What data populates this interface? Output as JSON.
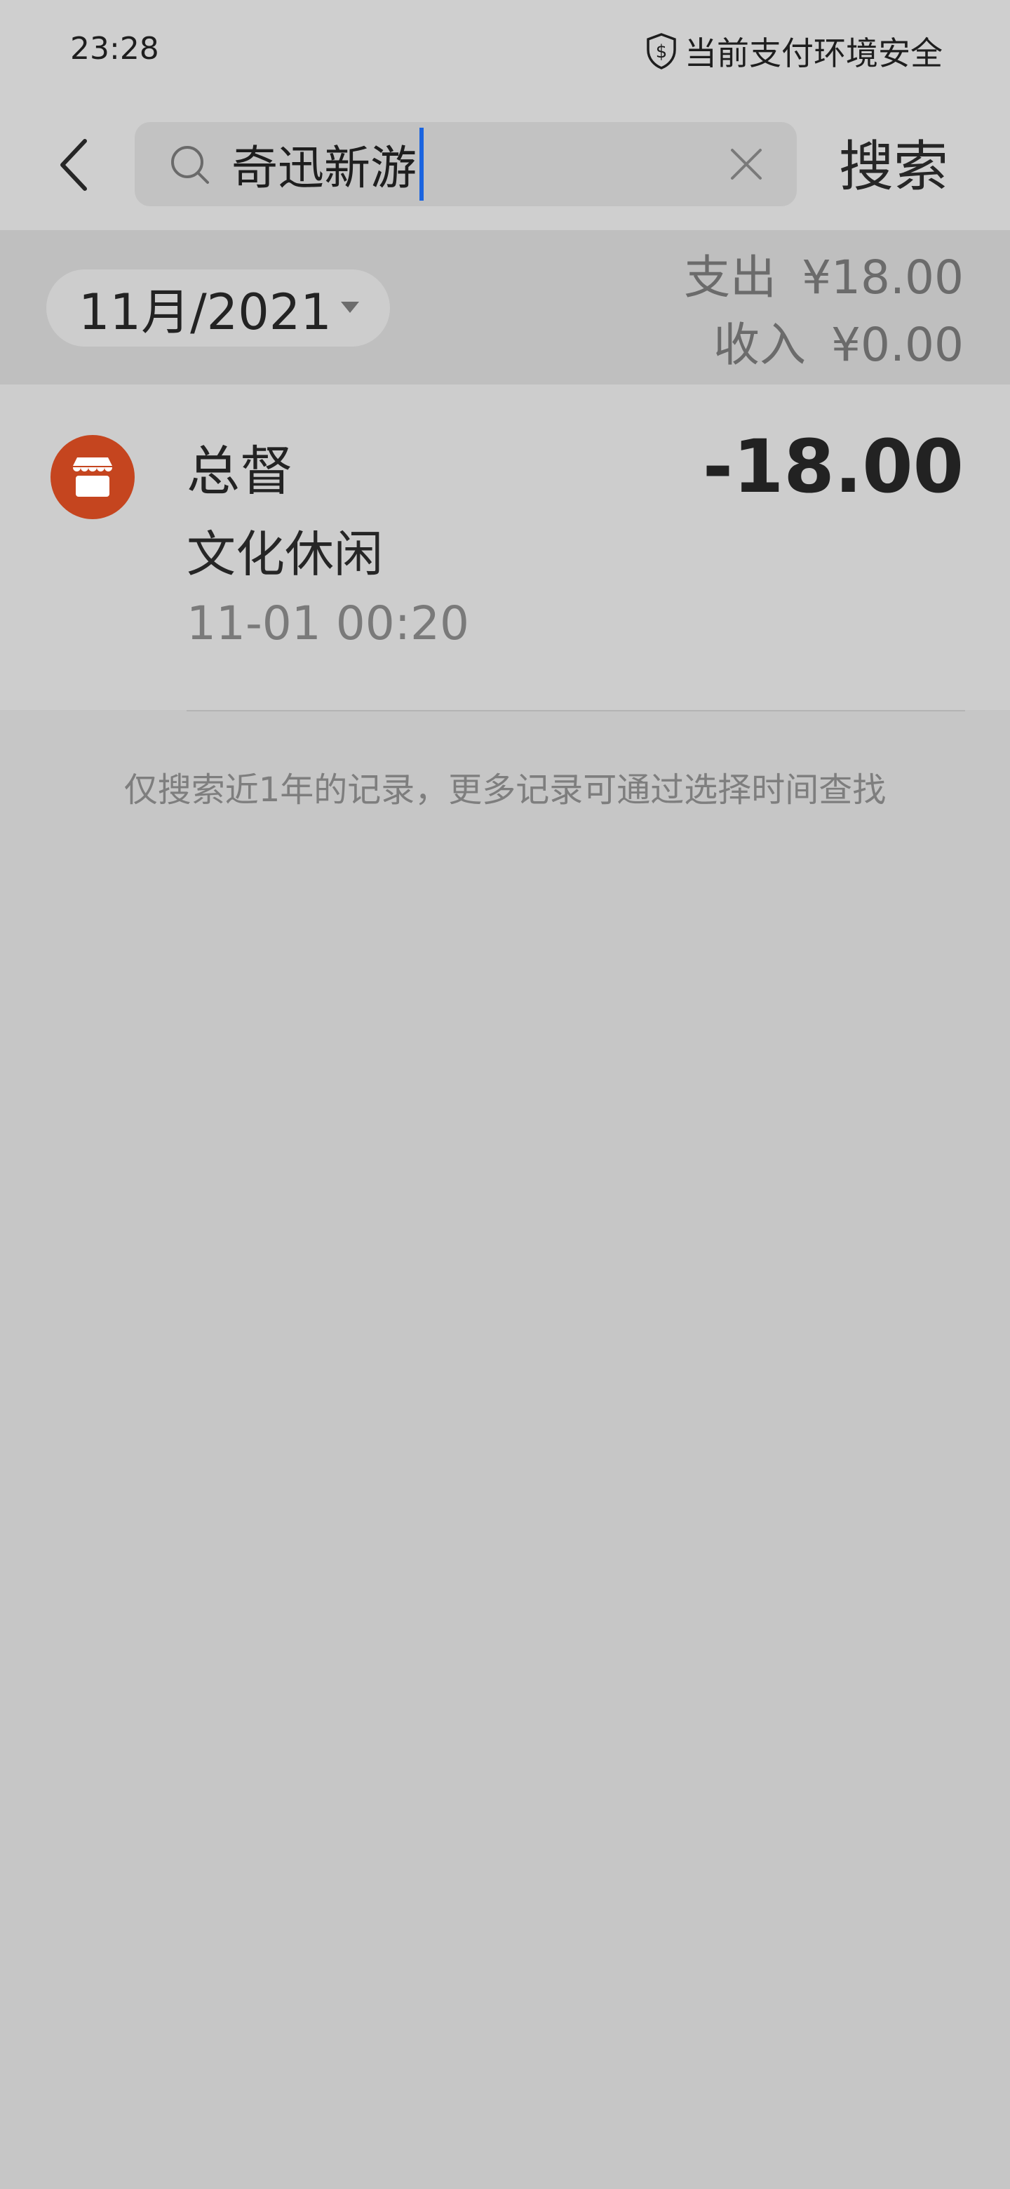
{
  "status_bar": {
    "time": "23:28",
    "security_text": "当前支付环境安全"
  },
  "search": {
    "query": "奇迅新游",
    "button_label": "搜索"
  },
  "filter": {
    "month": "11月/2021",
    "expense_label": "支出",
    "expense_value": "¥18.00",
    "income_label": "收入",
    "income_value": "¥0.00"
  },
  "transactions": [
    {
      "merchant": "总督",
      "category": "文化休闲",
      "time": "11-01  00:20",
      "amount": "-18.00",
      "icon": "store-icon"
    }
  ],
  "footer_note": "仅搜索近1年的记录，更多记录可通过选择时间查找",
  "colors": {
    "accent_caret": "#1a64e0",
    "icon_bg": "#c5451f"
  }
}
